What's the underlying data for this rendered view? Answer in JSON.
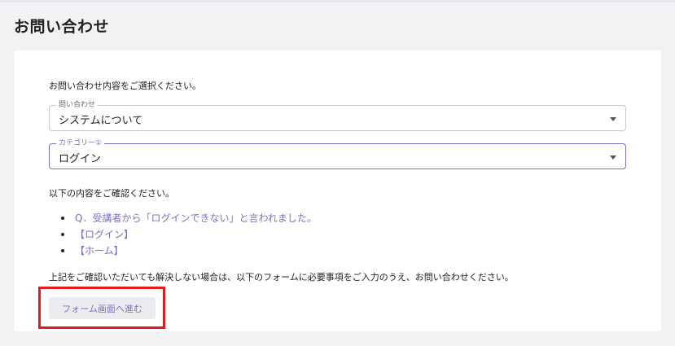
{
  "page": {
    "title": "お問い合わせ"
  },
  "card": {
    "intro": "お問い合わせ内容をご選択ください。",
    "inquiry_field": {
      "label": "問い合わせ",
      "value": "システムについて"
    },
    "category_field": {
      "label": "カテゴリー①",
      "value": "ログイン"
    },
    "confirm_text": "以下の内容をご確認ください。",
    "links": [
      {
        "label": "Q．受講者から「ログインできない」と言われました。"
      },
      {
        "label": "【ログイン】"
      },
      {
        "label": "【ホーム】"
      }
    ],
    "note": "上記をご確認いただいても解決しない場合は、以下のフォームに必要事項をご入力のうえ、お問い合わせください。",
    "form_button_label": "フォーム画面へ進む"
  },
  "colors": {
    "accent": "#7c6fc4",
    "highlight": "#e51b1b",
    "background": "#f2f2f4"
  },
  "icons": {
    "dropdown": "caret-down-icon"
  }
}
